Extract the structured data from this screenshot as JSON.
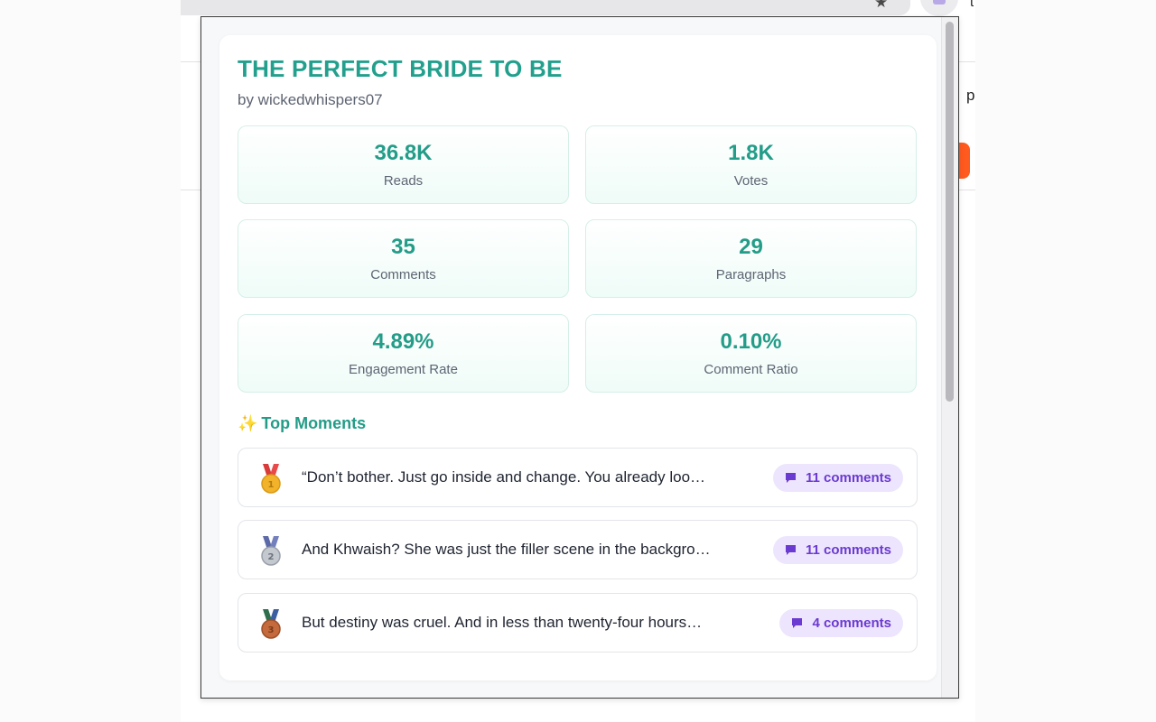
{
  "story": {
    "title": "THE PERFECT BRIDE TO BE",
    "author": "by wickedwhispers07"
  },
  "stats": [
    {
      "value": "36.8K",
      "label": "Reads"
    },
    {
      "value": "1.8K",
      "label": "Votes"
    },
    {
      "value": "35",
      "label": "Comments"
    },
    {
      "value": "29",
      "label": "Paragraphs"
    },
    {
      "value": "4.89%",
      "label": "Engagement Rate"
    },
    {
      "value": "0.10%",
      "label": "Comment Ratio"
    }
  ],
  "top_moments": {
    "icon": "sparkles-icon",
    "heading": "Top Moments",
    "items": [
      {
        "rank": "1",
        "medal": "gold-medal-icon",
        "text": "“Don’t bother. Just go inside and change. You already loo…",
        "comments": "11 comments"
      },
      {
        "rank": "2",
        "medal": "silver-medal-icon",
        "text": "And Khwaish? She was just the filler scene in the backgro…",
        "comments": "11 comments"
      },
      {
        "rank": "3",
        "medal": "bronze-medal-icon",
        "text": "But destiny was cruel. And in less than twenty-four hours…",
        "comments": "4 comments"
      }
    ]
  },
  "background": {
    "edge_letter_top": "t",
    "edge_letter_mid": "p"
  },
  "colors": {
    "accent": "#23a08d",
    "badge_bg": "#ede5fd",
    "badge_text": "#6b3ad1",
    "gold": "#f2b32b",
    "silver": "#b8bcc4",
    "bronze": "#c46a3c"
  }
}
